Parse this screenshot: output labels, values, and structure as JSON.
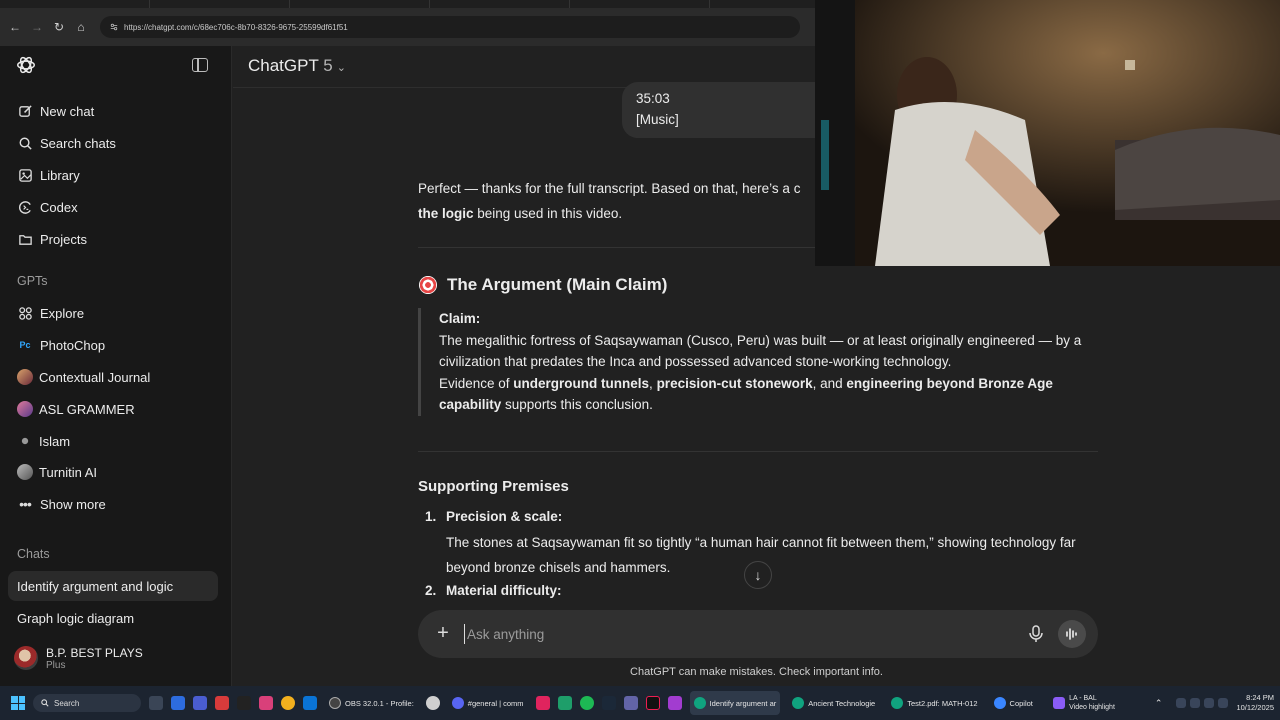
{
  "browser": {
    "url": "https://chatgpt.com/c/68ec706c-8b70-8326-9675-25599df61f51"
  },
  "sidebar": {
    "nav": [
      {
        "label": "New chat",
        "icon": "compose-icon"
      },
      {
        "label": "Search chats",
        "icon": "search-icon"
      },
      {
        "label": "Library",
        "icon": "library-icon"
      },
      {
        "label": "Codex",
        "icon": "codex-icon"
      },
      {
        "label": "Projects",
        "icon": "folder-icon"
      }
    ],
    "gpts_heading": "GPTs",
    "gpts": [
      {
        "label": "Explore",
        "icon": "grid-icon"
      },
      {
        "label": "PhotoChop",
        "icon": "photoshop-icon"
      },
      {
        "label": "Contextuall Journal",
        "icon": "gpt-avatar"
      },
      {
        "label": "ASL GRAMMER",
        "icon": "gpt-avatar"
      },
      {
        "label": "Islam",
        "icon": "gpt-avatar"
      },
      {
        "label": "Turnitin AI",
        "icon": "gpt-avatar"
      },
      {
        "label": "Show more",
        "icon": "more-icon"
      }
    ],
    "chats_heading": "Chats",
    "chats": [
      {
        "label": "Identify argument and logic",
        "active": true
      },
      {
        "label": "Graph logic diagram",
        "active": false
      }
    ],
    "user": {
      "name": "B.P. BEST PLAYS",
      "plan": "Plus"
    }
  },
  "header": {
    "model": "ChatGPT",
    "version": "5"
  },
  "conversation": {
    "user_message": {
      "line1": "35:03",
      "line2": "[Music]"
    },
    "intro": {
      "text": "Perfect — thanks for the full transcript. Based on that, here’s a c",
      "bold": "the logic",
      "rest": " being used in this video."
    },
    "argument_heading": "The Argument (Main Claim)",
    "claim": {
      "label": "Claim:",
      "text": "The megalithic fortress of Saqsaywaman (Cusco, Peru) was built — or at least originally engineered — by a civilization that predates the Inca and possessed advanced stone-working technology.",
      "evidence_prefix": "Evidence of ",
      "evidence_b1": "underground tunnels",
      "evidence_sep1": ", ",
      "evidence_b2": "precision-cut stonework",
      "evidence_sep2": ", and ",
      "evidence_b3": "engineering beyond Bronze Age capability",
      "evidence_suffix": " supports this conclusion."
    },
    "premises_heading": "Supporting Premises",
    "premises": [
      {
        "num": "1.",
        "title": "Precision & scale:",
        "body": "The stones at Saqsaywaman fit so tightly “a human hair cannot fit between them,” showing technology far beyond bronze chisels and hammers."
      },
      {
        "num": "2.",
        "title": "Material difficulty:",
        "body": ""
      }
    ]
  },
  "composer": {
    "placeholder": "Ask anything",
    "disclaimer": "ChatGPT can make mistakes. Check important info."
  },
  "taskbar": {
    "search": "Search",
    "apps": [
      {
        "label": "OBS 32.0.1 - Profile:",
        "color": "#444444",
        "active": false
      },
      {
        "label": "#general | comm",
        "color": "#5865f2",
        "active": false
      },
      {
        "label": "Identify argument ar",
        "color": "#10a37f",
        "active": true
      },
      {
        "label": "Ancient Technologie",
        "color": "#10a37f",
        "active": false
      },
      {
        "label": "Test2.pdf: MATH-012",
        "color": "#10a37f",
        "active": false
      },
      {
        "label": "Copilot",
        "color": "#3a86ff",
        "active": false
      }
    ],
    "weather": {
      "line1": "LA - BAL",
      "line2": "Video highlight"
    },
    "time": "8:24 PM",
    "date": "10/12/2025"
  }
}
